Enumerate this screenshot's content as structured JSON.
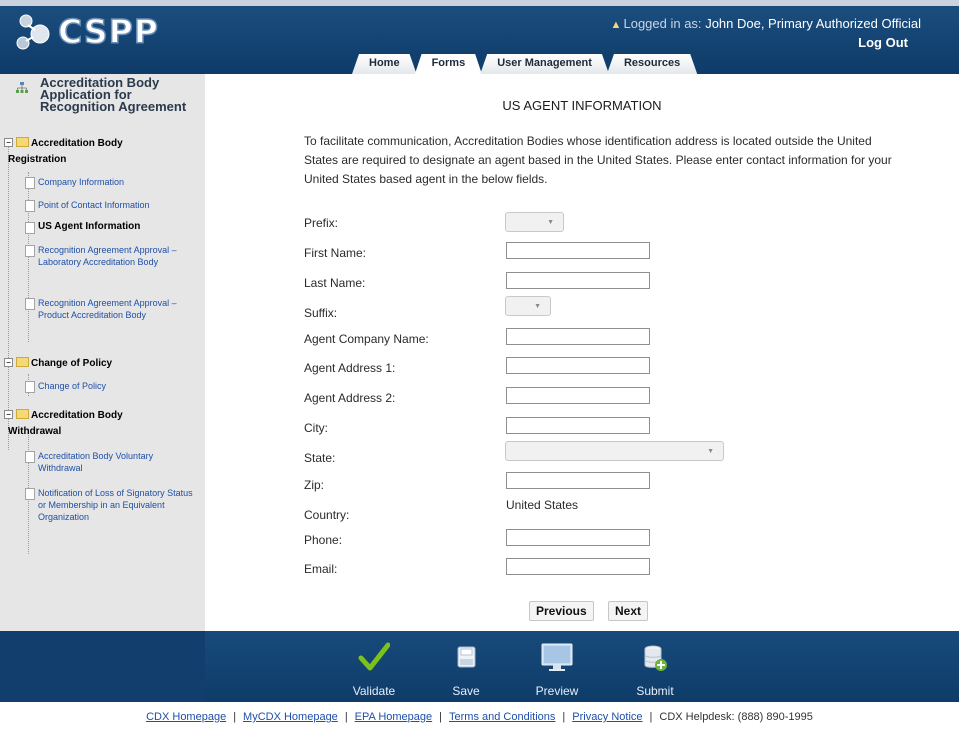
{
  "header": {
    "logo_text": "CSPP",
    "login_label": "Logged in as:",
    "login_user": "John Doe, Primary Authorized Official",
    "logout_label": "Log Out",
    "tabs": [
      {
        "label": "Home"
      },
      {
        "label": "Forms"
      },
      {
        "label": "User Management"
      },
      {
        "label": "Resources"
      }
    ],
    "active_tab": "Forms"
  },
  "sidebar": {
    "heading": "Accreditation Body Application for Recognition Agreement",
    "sections": [
      {
        "label_line1": "Accreditation Body",
        "label_line2": "Registration",
        "items": [
          "Company Information",
          "Point of Contact Information",
          "US Agent Information",
          "Recognition Agreement Approval – Laboratory Accreditation Body",
          "Recognition Agreement Approval – Product Accreditation Body"
        ]
      },
      {
        "label_line1": "Change of Policy",
        "label_line2": "",
        "items": [
          "Change of Policy"
        ]
      },
      {
        "label_line1": "Accreditation Body",
        "label_line2": "Withdrawal",
        "items": [
          "Accreditation Body Voluntary Withdrawal",
          "Notification of Loss of Signatory Status or Membership in an Equivalent Organization"
        ]
      }
    ],
    "current_item": "US Agent Information"
  },
  "form": {
    "title": "US AGENT INFORMATION",
    "intro": "To facilitate communication, Accreditation Bodies whose identification address is located outside the United States are required to designate an agent based in the United States. Please enter contact information for your United States based agent in the below fields.",
    "fields": {
      "prefix": {
        "label": "Prefix:",
        "value": ""
      },
      "first_name": {
        "label": "First Name:",
        "value": ""
      },
      "last_name": {
        "label": "Last Name:",
        "value": ""
      },
      "suffix": {
        "label": "Suffix:",
        "value": ""
      },
      "company": {
        "label": "Agent Company Name:",
        "value": ""
      },
      "address1": {
        "label": "Agent Address 1:",
        "value": ""
      },
      "address2": {
        "label": "Agent Address 2:",
        "value": ""
      },
      "city": {
        "label": "City:",
        "value": ""
      },
      "state": {
        "label": "State:",
        "value": ""
      },
      "zip": {
        "label": "Zip:",
        "value": ""
      },
      "country": {
        "label": "Country:",
        "value": "United States"
      },
      "phone": {
        "label": "Phone:",
        "value": ""
      },
      "email": {
        "label": "Email:",
        "value": ""
      }
    },
    "previous_label": "Previous",
    "next_label": "Next"
  },
  "toolbar": {
    "validate": "Validate",
    "save": "Save",
    "preview": "Preview",
    "submit": "Submit"
  },
  "footer": {
    "links": [
      "CDX Homepage",
      "MyCDX Homepage",
      "EPA Homepage",
      "Terms and Conditions",
      "Privacy Notice"
    ],
    "helpdesk": "CDX Helpdesk: (888) 890-1995"
  },
  "colors": {
    "header_bg": "#174a7b",
    "sidebar_bg": "#e6e6e6",
    "link": "#1f4fa8",
    "validate_check": "#7cc21b"
  }
}
